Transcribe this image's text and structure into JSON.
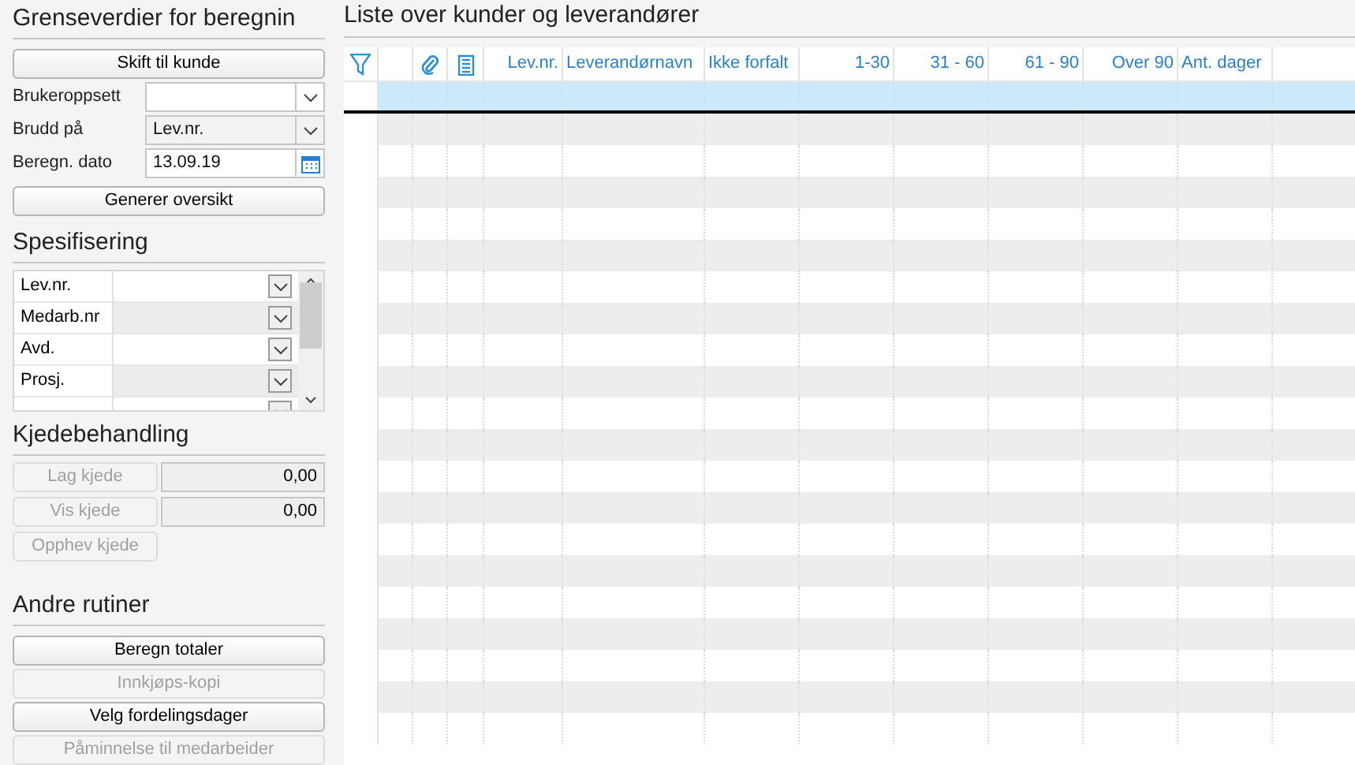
{
  "left": {
    "title": "Grenseverdier  for beregnin",
    "switch_button": {
      "label": "Skift til kunde",
      "disabled": false
    },
    "fields": [
      {
        "kind": "dropdown",
        "label": "Brukeroppsett"
      },
      {
        "kind": "dropdown",
        "label": "Brudd på",
        "value": "Lev.nr."
      },
      {
        "kind": "date",
        "label": "Beregn. dato",
        "value": "13.09.19"
      }
    ],
    "generate_button": {
      "label": "Generer oversikt",
      "disabled": false
    },
    "spec": {
      "title": "Spesifisering",
      "rows": [
        {
          "label": "Lev.nr."
        },
        {
          "label": "Medarb.nr"
        },
        {
          "label": "Avd."
        },
        {
          "label": "Prosj."
        }
      ]
    },
    "chain": {
      "title": "Kjedebehandling",
      "rows": [
        {
          "label": "Lag kjede",
          "disabled": true,
          "value": "0,00"
        },
        {
          "label": "Vis kjede",
          "disabled": true,
          "value": "0,00"
        },
        {
          "label": "Opphev kjede",
          "disabled": true
        }
      ]
    },
    "routines": {
      "title": "Andre rutiner",
      "buttons": [
        {
          "label": "Beregn totaler",
          "disabled": false
        },
        {
          "label": "Innkjøps-kopi",
          "disabled": true
        },
        {
          "label": "Velg fordelingsdager",
          "disabled": false
        },
        {
          "label": "Påminnelse til  medarbeider",
          "disabled": true
        }
      ]
    }
  },
  "table": {
    "title": "Liste over kunder og leverandører",
    "columns": [
      {
        "kind": "filter"
      },
      {
        "kind": "blank"
      },
      {
        "kind": "attachment"
      },
      {
        "kind": "document"
      },
      {
        "kind": "number",
        "label": "Lev.nr."
      },
      {
        "kind": "text",
        "label": "Leverandørnavn"
      },
      {
        "kind": "text",
        "label": "Ikke forfalt"
      },
      {
        "kind": "number",
        "label": "1-30"
      },
      {
        "kind": "number",
        "label": "31 - 60"
      },
      {
        "kind": "number",
        "label": "61 - 90"
      },
      {
        "kind": "number",
        "label": "Over 90"
      },
      {
        "kind": "text",
        "label": "Ant. dager"
      }
    ]
  }
}
